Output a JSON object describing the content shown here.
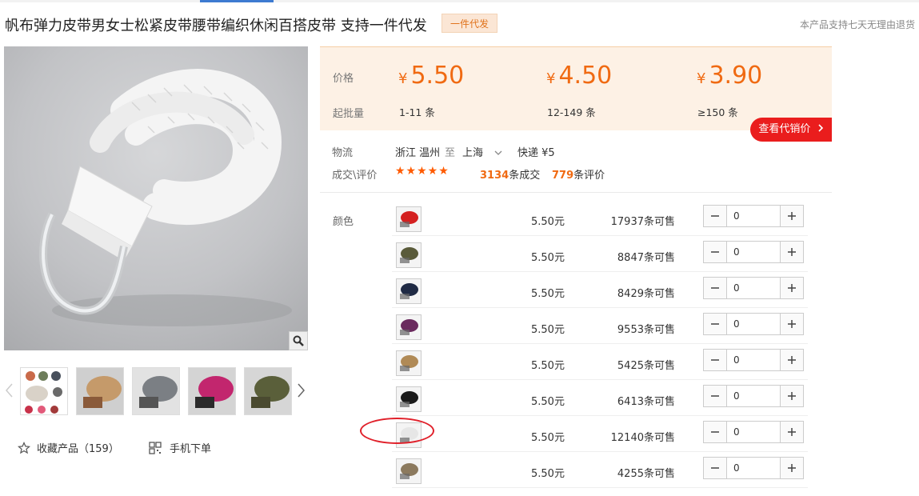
{
  "header": {
    "title": "帆布弹力皮带男女士松紧皮带腰带编织休闲百搭皮带 支持一件代发",
    "badge": "一件代发",
    "return_note": "本产品支持七天无理由退货"
  },
  "gallery": {
    "zoom_icon": "search-icon",
    "prev_icon": "chevron-left-icon",
    "next_icon": "chevron-right-icon"
  },
  "actions": {
    "favorite_label": "收藏产品（159）",
    "mobile_label": "手机下单"
  },
  "pricing": {
    "price_label": "价格",
    "moq_label": "起批量",
    "currency": "¥",
    "tiers": [
      {
        "price": "5.50",
        "range": "1-11 条"
      },
      {
        "price": "4.50",
        "range": "12-149 条"
      },
      {
        "price": "3.90",
        "range": "≥150 条"
      }
    ],
    "agent_button": "查看代销价"
  },
  "logistics": {
    "label": "物流",
    "from": "浙江 温州",
    "to_word": "至",
    "to": "上海",
    "shipping": "快递 ¥5"
  },
  "deals": {
    "label": "成交\\评价",
    "stars": "★★★★★",
    "rating": 5,
    "deal_count": "3134",
    "deal_suffix": "条成交",
    "review_count": "779",
    "review_suffix": "条评价"
  },
  "colors_label": "颜色",
  "skus": [
    {
      "price": "5.50元",
      "stock": "17937条可售",
      "qty": "0",
      "swatch": "#d42020"
    },
    {
      "price": "5.50元",
      "stock": "8847条可售",
      "qty": "0",
      "swatch": "#5a5b3a"
    },
    {
      "price": "5.50元",
      "stock": "8429条可售",
      "qty": "0",
      "swatch": "#1f2a44"
    },
    {
      "price": "5.50元",
      "stock": "9553条可售",
      "qty": "0",
      "swatch": "#6a2a5e"
    },
    {
      "price": "5.50元",
      "stock": "5425条可售",
      "qty": "0",
      "swatch": "#b08a56"
    },
    {
      "price": "5.50元",
      "stock": "6413条可售",
      "qty": "0",
      "swatch": "#1a1a1a"
    },
    {
      "price": "5.50元",
      "stock": "12140条可售",
      "qty": "0",
      "swatch": "#e6e6e6"
    },
    {
      "price": "5.50元",
      "stock": "4255条可售",
      "qty": "0",
      "swatch": "#8c7a5e"
    }
  ],
  "colors": {
    "price_accent": "#f06a12",
    "button_red": "#ea1d1d",
    "panel_bg": "#fdf1e5",
    "star": "#ff5b00"
  }
}
